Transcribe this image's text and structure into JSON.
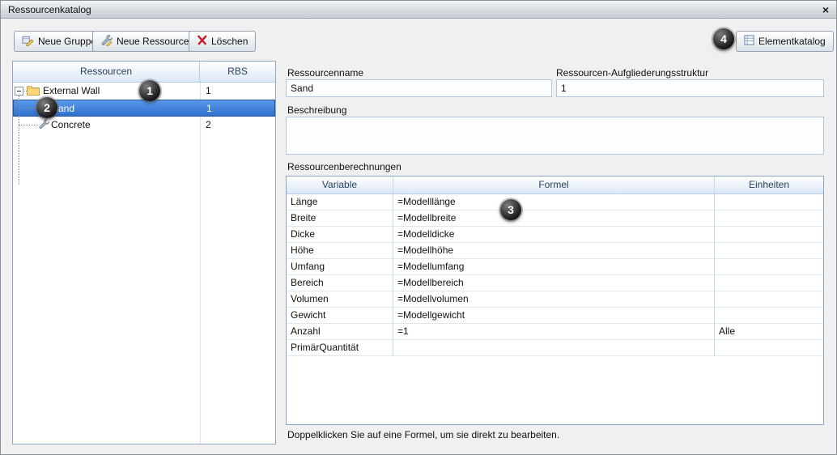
{
  "window": {
    "title": "Ressourcenkatalog"
  },
  "icons": {
    "close": "×"
  },
  "toolbar": {
    "new_group_label": "Neue Gruppe",
    "new_resource_label": "Neue Ressource",
    "delete_label": "Löschen",
    "element_catalog_label": "Elementkatalog"
  },
  "tree": {
    "columns": {
      "resources": "Ressourcen",
      "rbs": "RBS"
    },
    "items": [
      {
        "label": "External Wall",
        "rbs": "1",
        "type": "group",
        "expanded": true,
        "selected": false
      },
      {
        "label": "Sand",
        "rbs": "1",
        "type": "resource",
        "selected": true
      },
      {
        "label": "Concrete",
        "rbs": "2",
        "type": "resource",
        "selected": false
      }
    ]
  },
  "form": {
    "resource_name_label": "Ressourcenname",
    "resource_name_value": "Sand",
    "rbs_label": "Ressourcen-Aufgliederungsstruktur",
    "rbs_value": "1",
    "description_label": "Beschreibung",
    "description_value": "",
    "calculations_label": "Ressourcenberechnungen"
  },
  "calc_table": {
    "columns": {
      "variable": "Variable",
      "formula": "Formel",
      "units": "Einheiten"
    },
    "rows": [
      {
        "variable": "Länge",
        "formula": "=Modelllänge",
        "units": ""
      },
      {
        "variable": "Breite",
        "formula": "=Modellbreite",
        "units": ""
      },
      {
        "variable": "Dicke",
        "formula": "=Modelldicke",
        "units": ""
      },
      {
        "variable": "Höhe",
        "formula": "=Modellhöhe",
        "units": ""
      },
      {
        "variable": "Umfang",
        "formula": "=Modellumfang",
        "units": ""
      },
      {
        "variable": "Bereich",
        "formula": "=Modellbereich",
        "units": ""
      },
      {
        "variable": "Volumen",
        "formula": "=Modellvolumen",
        "units": ""
      },
      {
        "variable": "Gewicht",
        "formula": "=Modellgewicht",
        "units": ""
      },
      {
        "variable": "Anzahl",
        "formula": "=1",
        "units": "Alle"
      },
      {
        "variable": "PrimärQuantität",
        "formula": "",
        "units": ""
      }
    ],
    "hint": "Doppelklicken Sie auf eine Formel, um sie direkt zu bearbeiten."
  },
  "annotations": {
    "one": "1",
    "two": "2",
    "three": "3",
    "four": "4"
  },
  "colors": {
    "selection": "#2f70cd",
    "header_text": "#27425f",
    "panel_border": "#92a7c2",
    "delete_red": "#c8202a"
  }
}
